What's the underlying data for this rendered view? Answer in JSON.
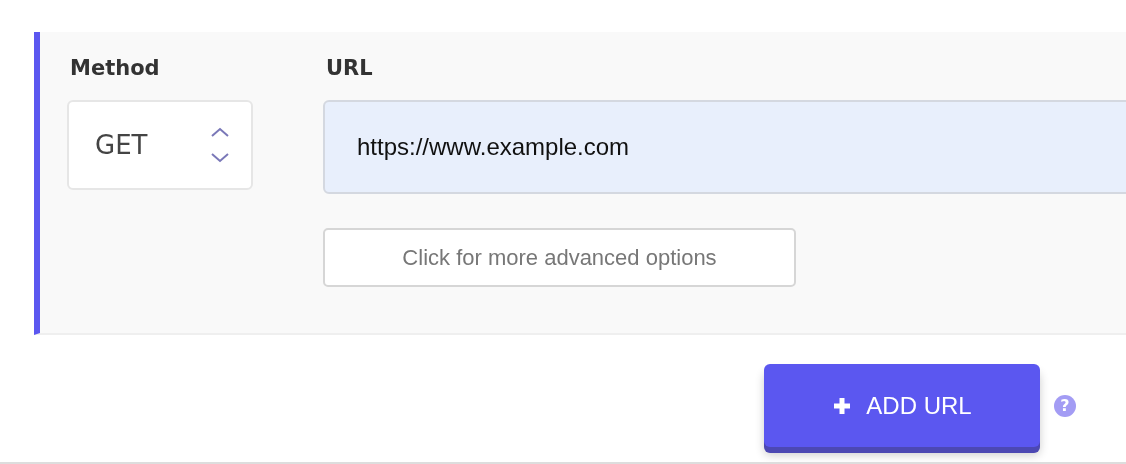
{
  "method": {
    "label": "Method",
    "value": "GET"
  },
  "url": {
    "label": "URL",
    "value": "https://www.example.com"
  },
  "advanced_button": "Click for more advanced options",
  "add_button": "ADD URL",
  "help_icon": "?"
}
